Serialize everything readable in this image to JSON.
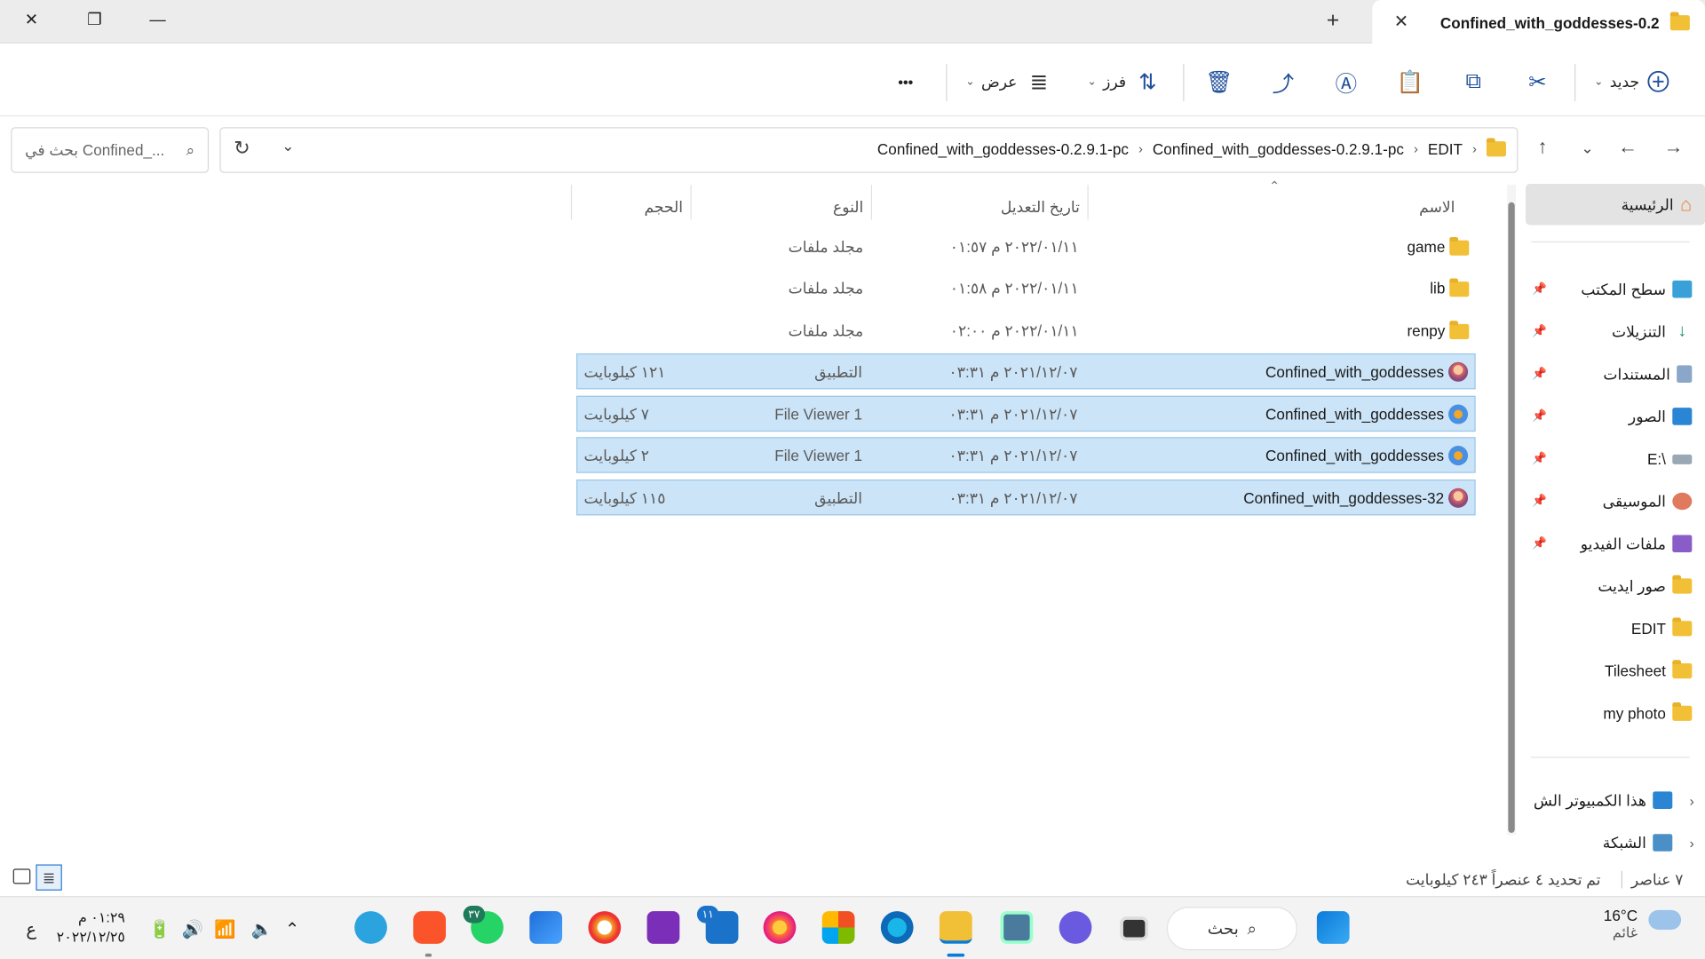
{
  "window": {
    "tab_title": "Confined_with_goddesses-0.2",
    "close_glyph": "✕",
    "restore_glyph": "❐",
    "minimize_glyph": "—",
    "new_tab_glyph": "+"
  },
  "toolbar": {
    "new_label": "جديد",
    "sort_label": "فرز",
    "view_label": "عرض",
    "more_glyph": "•••",
    "icons": [
      "new-icon",
      "cut-icon",
      "copy-icon",
      "paste-icon",
      "rename-icon",
      "share-icon",
      "delete-icon",
      "sort-icon",
      "view-icon",
      "more-icon"
    ]
  },
  "address": {
    "crumbs": [
      "EDIT",
      "Confined_with_goddesses-0.2.9.1-pc",
      "Confined_with_goddesses-0.2.9.1-pc"
    ],
    "search_placeholder": "بحث في Confined_..."
  },
  "sidebar": {
    "items": [
      {
        "label": "الرئيسية",
        "icon": "home-icon",
        "pinned": false,
        "selected": true
      },
      {
        "label": "سطح المكتب",
        "icon": "desktop-icon",
        "pinned": true
      },
      {
        "label": "التنزيلات",
        "icon": "download-icon",
        "pinned": true
      },
      {
        "label": "المستندات",
        "icon": "documents-icon",
        "pinned": true
      },
      {
        "label": "الصور",
        "icon": "pictures-icon",
        "pinned": true
      },
      {
        "label": "E:\\",
        "icon": "drive-icon",
        "pinned": true
      },
      {
        "label": "الموسيقى",
        "icon": "music-icon",
        "pinned": true
      },
      {
        "label": "ملفات الفيديو",
        "icon": "videos-icon",
        "pinned": true
      },
      {
        "label": "صور ايديت",
        "icon": "folder-icon",
        "pinned": false
      },
      {
        "label": "EDIT",
        "icon": "folder-warning-icon",
        "pinned": false
      },
      {
        "label": "Tilesheet",
        "icon": "folder-icon",
        "pinned": false
      },
      {
        "label": "my photo",
        "icon": "folder-icon",
        "pinned": false
      },
      {
        "label": "هذا الكمبيوتر الش",
        "icon": "computer-icon",
        "pinned": false
      },
      {
        "label": "الشبكة",
        "icon": "network-icon",
        "pinned": false
      }
    ]
  },
  "columns": {
    "name": "الاسم",
    "date": "تاريخ التعديل",
    "type": "النوع",
    "size": "الحجم"
  },
  "files": [
    {
      "name": "game",
      "date": "٢٠٢٢/٠١/١١ م ٠١:٥٧",
      "type": "مجلد ملفات",
      "size": "",
      "icon": "folder-icon",
      "selected": false
    },
    {
      "name": "lib",
      "date": "٢٠٢٢/٠١/١١ م ٠١:٥٨",
      "type": "مجلد ملفات",
      "size": "",
      "icon": "folder-icon",
      "selected": false
    },
    {
      "name": "renpy",
      "date": "٢٠٢٢/٠١/١١ م ٠٢:٠٠",
      "type": "مجلد ملفات",
      "size": "",
      "icon": "folder-icon",
      "selected": false
    },
    {
      "name": "Confined_with_goddesses",
      "date": "٢٠٢١/١٢/٠٧ م ٠٣:٣١",
      "type": "التطبيق",
      "size": "١٢١ كيلوبايت",
      "icon": "app-icon",
      "selected": true
    },
    {
      "name": "Confined_with_goddesses",
      "date": "٢٠٢١/١٢/٠٧ م ٠٣:٣١",
      "type": "File Viewer 1",
      "size": "٧ كيلوبايت",
      "icon": "script-icon",
      "selected": true
    },
    {
      "name": "Confined_with_goddesses",
      "date": "٢٠٢١/١٢/٠٧ م ٠٣:٣١",
      "type": "File Viewer 1",
      "size": "٢ كيلوبايت",
      "icon": "script-icon",
      "selected": true
    },
    {
      "name": "Confined_with_goddesses-32",
      "date": "٢٠٢١/١٢/٠٧ م ٠٣:٣١",
      "type": "التطبيق",
      "size": "١١٥ كيلوبايت",
      "icon": "app-icon",
      "selected": true
    }
  ],
  "status": {
    "count": "٧ عناصر",
    "selection": "تم تحديد ٤ عنصراً ٢٤٣ كيلوبايت"
  },
  "taskbar": {
    "weather_temp": "16°C",
    "weather_text": "غائم",
    "search_label": "بحث",
    "clock_time": "٠١:٢٩ م",
    "clock_date": "٢٠٢٢/١٢/٢٥",
    "whatsapp_badge": "٣٧",
    "mail_badge": "١١"
  },
  "colors": {
    "accent": "#0067c0",
    "selection": "#cce4f7",
    "folder": "#f2c037"
  }
}
